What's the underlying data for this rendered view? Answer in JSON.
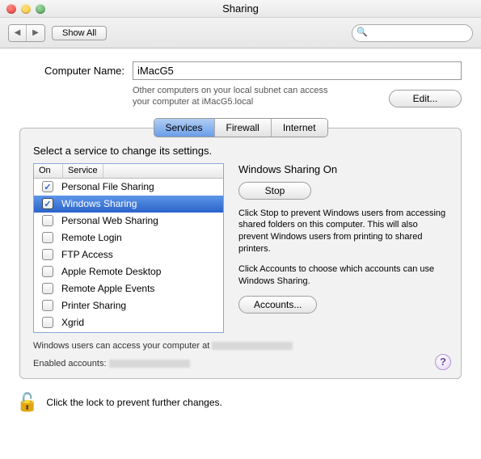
{
  "window": {
    "title": "Sharing"
  },
  "toolbar": {
    "show_all": "Show All",
    "search_placeholder": ""
  },
  "name": {
    "label": "Computer Name:",
    "value": "iMacG5",
    "hint": "Other computers on your local subnet can access your computer at iMacG5.local",
    "edit": "Edit..."
  },
  "tabs": {
    "services": "Services",
    "firewall": "Firewall",
    "internet": "Internet",
    "active": "services"
  },
  "group": {
    "prompt": "Select a service to change its settings.",
    "col_on": "On",
    "col_service": "Service",
    "items": [
      {
        "label": "Personal File Sharing",
        "checked": true,
        "selected": false
      },
      {
        "label": "Windows Sharing",
        "checked": true,
        "selected": true
      },
      {
        "label": "Personal Web Sharing",
        "checked": false,
        "selected": false
      },
      {
        "label": "Remote Login",
        "checked": false,
        "selected": false
      },
      {
        "label": "FTP Access",
        "checked": false,
        "selected": false
      },
      {
        "label": "Apple Remote Desktop",
        "checked": false,
        "selected": false
      },
      {
        "label": "Remote Apple Events",
        "checked": false,
        "selected": false
      },
      {
        "label": "Printer Sharing",
        "checked": false,
        "selected": false
      },
      {
        "label": "Xgrid",
        "checked": false,
        "selected": false
      }
    ]
  },
  "detail": {
    "heading": "Windows Sharing On",
    "stop": "Stop",
    "desc": "Click Stop to prevent Windows users from accessing shared folders on this computer. This will also prevent Windows users from printing to shared printers.",
    "accounts_hint": "Click Accounts to choose which accounts can use Windows Sharing.",
    "accounts": "Accounts..."
  },
  "footer": {
    "line1": "Windows users can access your computer at ",
    "line2": "Enabled accounts:"
  },
  "lock": {
    "text": "Click the lock to prevent further changes."
  }
}
